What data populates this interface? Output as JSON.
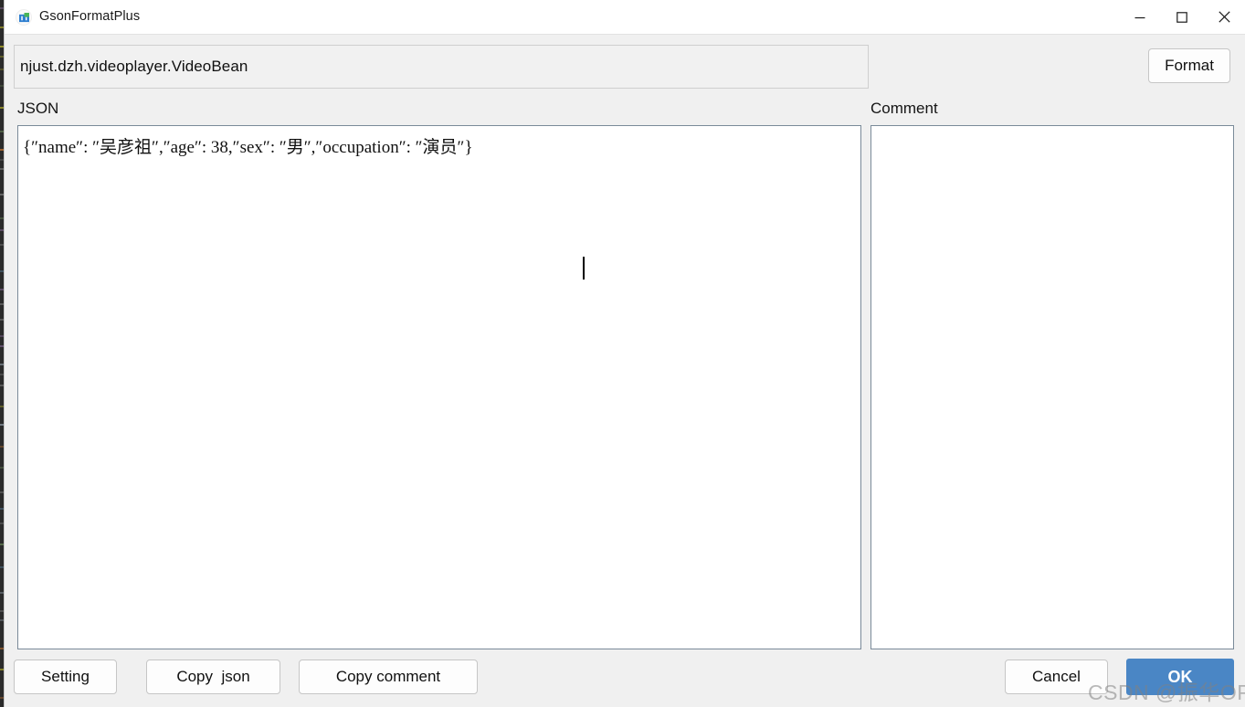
{
  "window": {
    "title": "GsonFormatPlus",
    "icon": "app-icon",
    "controls": {
      "minimize": "minimize-icon",
      "maximize": "maximize-icon",
      "close": "close-icon"
    }
  },
  "toolbar": {
    "classname_value": "njust.dzh.videoplayer.VideoBean",
    "classname_placeholder": "",
    "format_label": "Format"
  },
  "panels": {
    "json": {
      "label": "JSON",
      "value": "{″name″: ″吴彦祖″,″age″: 38,″sex″: ″男″,″occupation″: ″演员″}",
      "placeholder": ""
    },
    "comment": {
      "label": "Comment",
      "value": "",
      "placeholder": ""
    }
  },
  "footer": {
    "setting_label": "Setting",
    "copy_json_label": "Copy  json",
    "copy_comment_label": "Copy comment",
    "cancel_label": "Cancel",
    "ok_label": "OK"
  },
  "watermark": {
    "text": "CSDN @振华OPPO"
  },
  "colors": {
    "accent": "#4a86c5",
    "window_bg": "#f0f0f0",
    "titlebar_bg": "#ffffff",
    "editor_border": "#7a8a99",
    "field_bg": "#f1f1f1"
  }
}
